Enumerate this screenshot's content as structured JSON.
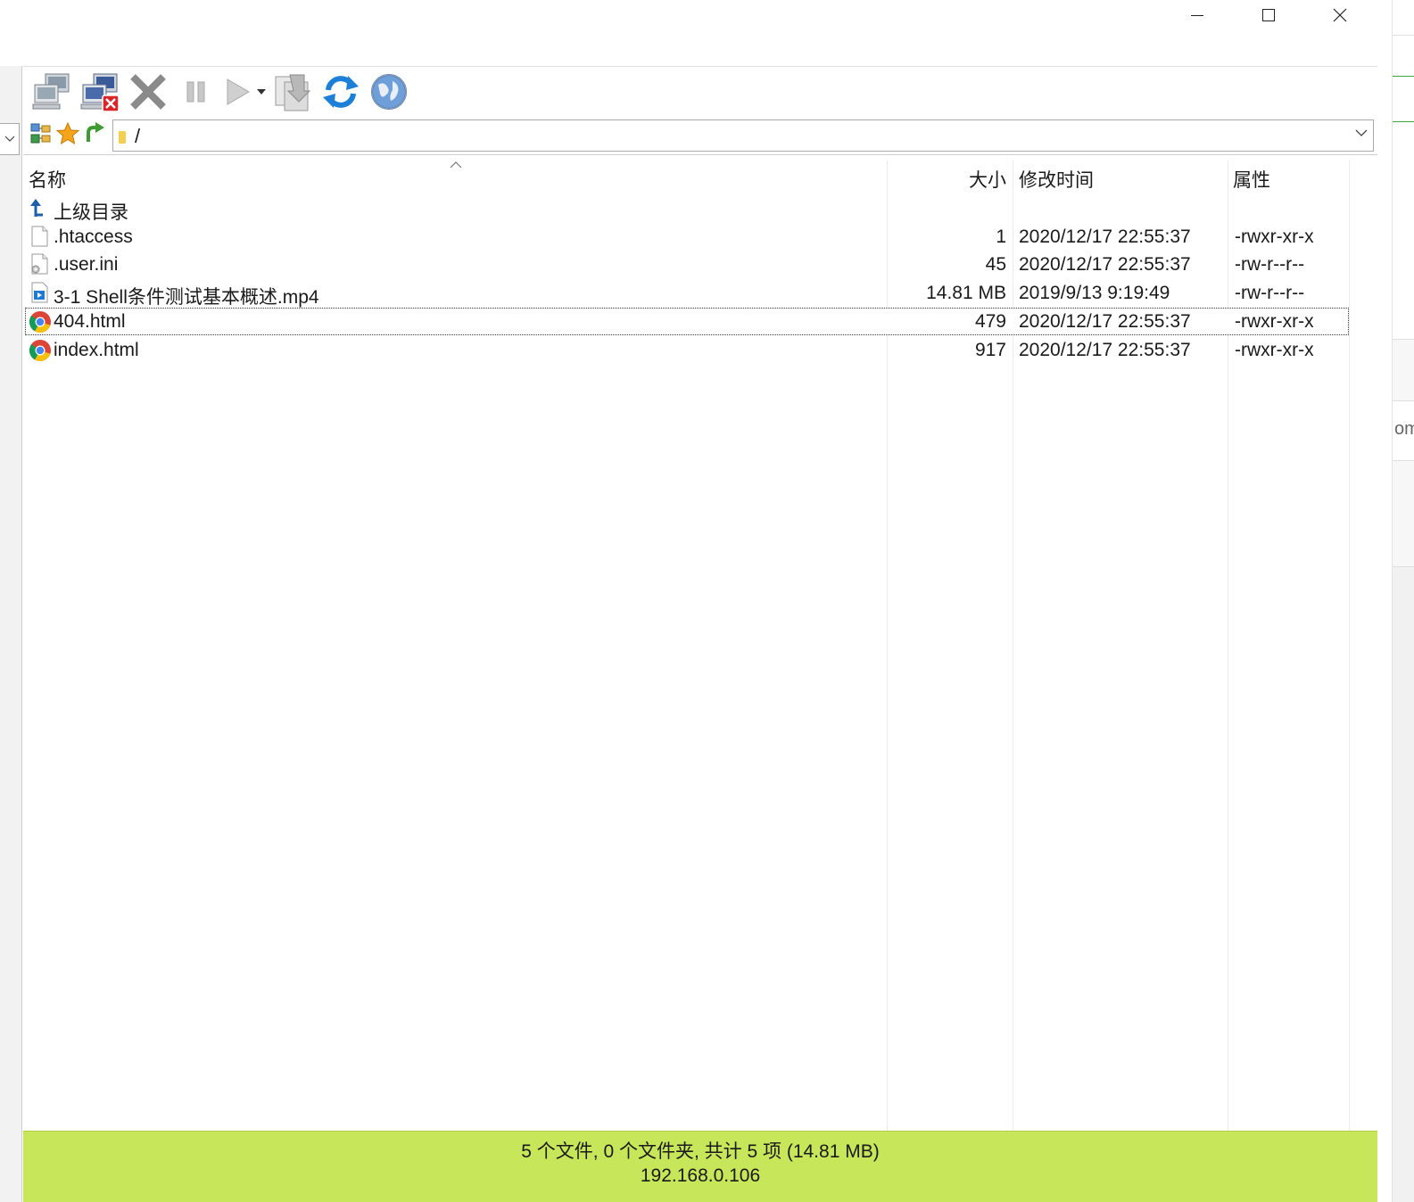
{
  "window": {
    "controls": [
      "minimize-icon",
      "maximize-icon",
      "close-icon"
    ]
  },
  "toolbar": {
    "buttons": [
      "connect-icon",
      "disconnect-icon",
      "cancel-x-icon",
      "pause-icon",
      "play-icon",
      "play-dropdown-icon",
      "transfer-queue-icon",
      "refresh-icon",
      "globe-icon"
    ]
  },
  "address": {
    "path": "/"
  },
  "list": {
    "columns": {
      "name": "名称",
      "size": "大小",
      "mtime": "修改时间",
      "attr": "属性"
    },
    "rows": [
      {
        "icon": "parent-dir-icon",
        "name": "上级目录",
        "size": "",
        "mtime": "",
        "attr": ""
      },
      {
        "icon": "blank-file-icon",
        "name": ".htaccess",
        "size": "1",
        "mtime": "2020/12/17 22:55:37",
        "attr": "-rwxr-xr-x"
      },
      {
        "icon": "settings-file-icon",
        "name": ".user.ini",
        "size": "45",
        "mtime": "2020/12/17 22:55:37",
        "attr": "-rw-r--r--"
      },
      {
        "icon": "video-file-icon",
        "name": "3-1 Shell条件测试基本概述.mp4",
        "size": "14.81 MB",
        "mtime": "2019/9/13 9:19:49",
        "attr": "-rw-r--r--"
      },
      {
        "icon": "chrome-html-icon",
        "name": "404.html",
        "size": "479",
        "mtime": "2020/12/17 22:55:37",
        "attr": "-rwxr-xr-x"
      },
      {
        "icon": "chrome-html-icon",
        "name": "index.html",
        "size": "917",
        "mtime": "2020/12/17 22:55:37",
        "attr": "-rwxr-xr-x"
      }
    ],
    "focused_row": 4
  },
  "status": {
    "summary": "5 个文件, 0 个文件夹, 共计 5 项 (14.81 MB)",
    "host": "192.168.0.106",
    "color": "#c8e65a"
  },
  "right_strip": {
    "text": "om"
  }
}
